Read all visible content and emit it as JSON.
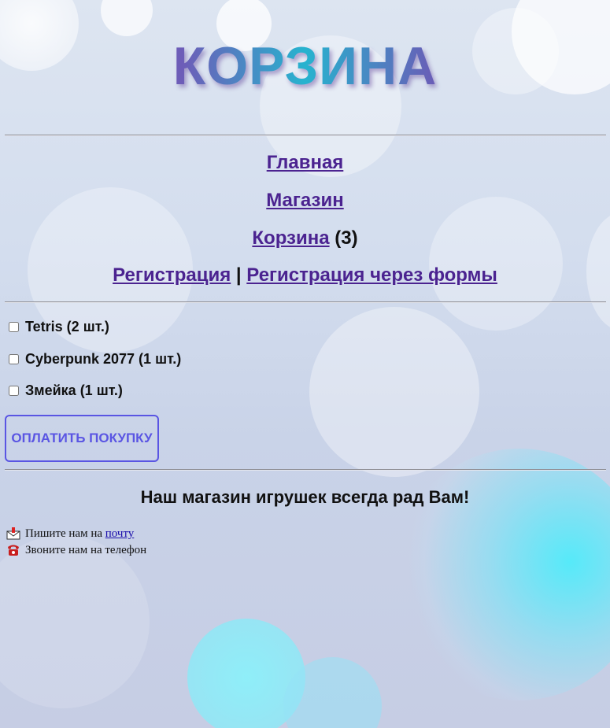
{
  "header": {
    "title": "КОРЗИНА"
  },
  "nav": {
    "home": "Главная",
    "shop": "Магазин",
    "cart": "Корзина",
    "cart_count": "(3)",
    "register": "Регистрация",
    "separator": "|",
    "register_forms": "Регистрация через формы"
  },
  "cart": {
    "items": [
      {
        "label": "Tetris (2 шт.)",
        "checked": false
      },
      {
        "label": "Cyberpunk 2077 (1 шт.)",
        "checked": false
      },
      {
        "label": "Змейка (1 шт.)",
        "checked": false
      }
    ],
    "pay_button": "ОПЛАТИТЬ ПОКУПКУ"
  },
  "footer": {
    "heading": "Наш магазин игрушек всегда рад Вам!",
    "mail_text": "Пишите нам на",
    "mail_link": "почту",
    "phone_text": "Звоните нам на телефон",
    "mail_icon": "mail-icon",
    "phone_icon": "phone-icon"
  },
  "colors": {
    "link": "#4b2390",
    "accent_button": "#5a55e3",
    "title_gradient": [
      "#7756b4",
      "#27b3cf"
    ]
  }
}
